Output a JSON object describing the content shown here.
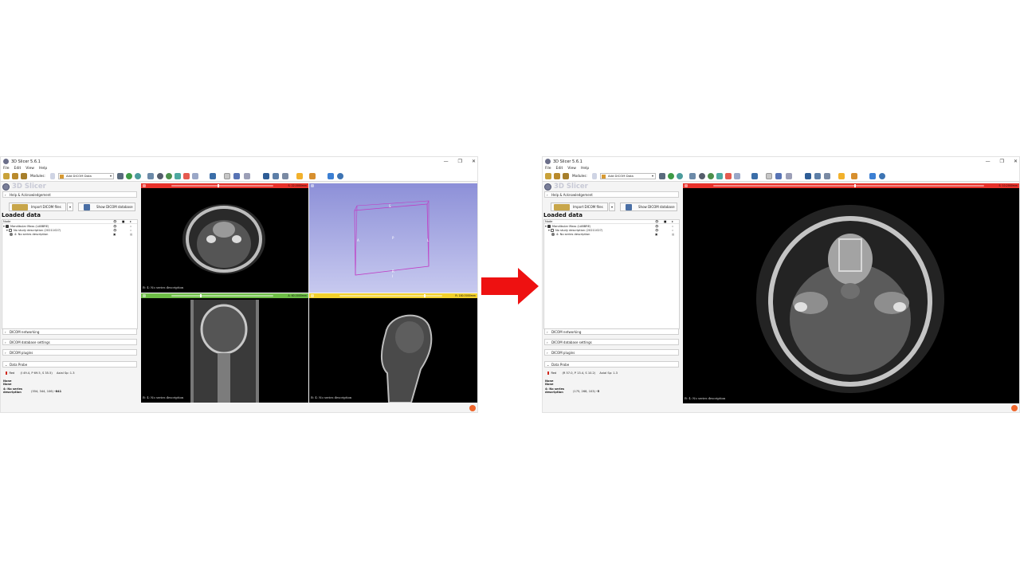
{
  "window": {
    "title": "3D Slicer 5.6.1",
    "controls": [
      "—",
      "❐",
      "✕"
    ]
  },
  "menu": [
    "File",
    "Edit",
    "View",
    "Help"
  ],
  "toolbar": {
    "modules_label": "Modules:",
    "module_selected": "Add DICOM Data"
  },
  "logo_text": "3D Slicer",
  "sections": {
    "help": "Help & Acknowledgement",
    "networking": "DICOM networking",
    "db_settings": "DICOM database settings",
    "plugins": "DICOM plugins",
    "probe": "Data Probe"
  },
  "buttons": {
    "import": "Import DICOM files",
    "show_db": "Show DICOM database"
  },
  "loaded_data": {
    "title": "Loaded data",
    "header": "Node",
    "rows": [
      {
        "label": "Mandibular Mass (LABBRE)",
        "indent": 0
      },
      {
        "label": "No study description (20211027)",
        "indent": 1
      },
      {
        "label": "4: No series description",
        "indent": 2
      }
    ]
  },
  "left_screenshot": {
    "probe": {
      "view": "Red",
      "coords": "(I 49.4, P 69.5, S 35.5)",
      "axial": "Axial Sp: 1.3",
      "none1": "None",
      "none2": "None",
      "series": "4: No series description",
      "series_value": "(354, 344, 106)",
      "series_value_bold": "-841"
    },
    "views": {
      "red_value": "S: 22.0000mm",
      "red_label": "B: 4: No series description",
      "green_value": "A: 60.0000mm",
      "green_label": "B: 4: No series description",
      "yellow_value": "R: 180.5000mm",
      "yellow_label": "B: 4: No series description",
      "box_labels": [
        "S",
        "A",
        "L",
        "P",
        "R",
        "I"
      ]
    }
  },
  "right_screenshot": {
    "probe": {
      "view": "Red",
      "coords": "(R 57.0, P 13.4, S 10.2)",
      "axial": "Axial Sp: 1.3",
      "none1": "None",
      "none2": "None",
      "series": "4: No series description",
      "series_value": "(175, 268, 103)",
      "series_value_bold": "-5"
    },
    "views": {
      "red_value": "S: 10.2000mm",
      "red_label": "B: 4: No series description"
    }
  },
  "colors": {
    "red_view": "#e8322b",
    "green_view": "#6dbd46",
    "yellow_view": "#f2d12e",
    "blue_view": "#8d90d8",
    "arrow": "#ee1111"
  }
}
